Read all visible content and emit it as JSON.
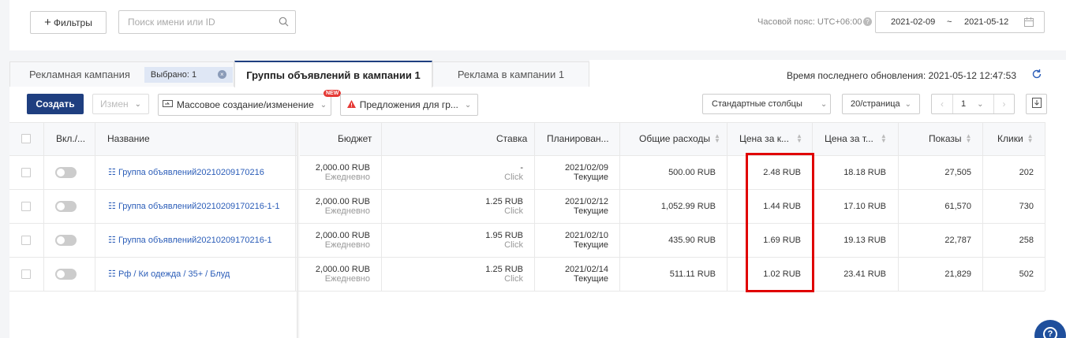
{
  "toolbar": {
    "filters_label": "Фильтры",
    "search_placeholder": "Поиск имени или ID",
    "timezone_label": "Часовой пояс: UTC+06:00",
    "date_start": "2021-02-09",
    "date_sep": "~",
    "date_end": "2021-05-12"
  },
  "tabs": {
    "campaign": "Рекламная кампания",
    "selected_badge": "Выбрано: 1",
    "groups": "Группы объявлений в кампании 1",
    "ads": "Реклама в кампании 1",
    "last_update": "Время последнего обновления: 2021-05-12 12:47:53"
  },
  "actions": {
    "create": "Создать",
    "edit": "Измен",
    "bulk": "Массовое создание/изменение",
    "new_badge": "NEW",
    "suggestions": "Предложения для гр...",
    "columns": "Стандартные столбцы",
    "page_size": "20/страница",
    "page": "1"
  },
  "columns": {
    "toggle": "Вкл./...",
    "name": "Название",
    "budget": "Бюджет",
    "bid": "Ставка",
    "schedule": "Планирован...",
    "spend": "Общие расходы",
    "cpc": "Цена за к...",
    "cpm": "Цена за т...",
    "impressions": "Показы",
    "clicks": "Клики"
  },
  "rows": [
    {
      "name": "Группа объявлений20210209170216",
      "budget": "2,000.00 RUB",
      "budget_type": "Ежедневно",
      "bid": "-",
      "bid_type": "Click",
      "date": "2021/02/09",
      "status": "Текущие",
      "spend": "500.00 RUB",
      "cpc": "2.48 RUB",
      "cpm": "18.18 RUB",
      "impressions": "27,505",
      "clicks": "202"
    },
    {
      "name": "Группа объявлений20210209170216-1-1",
      "budget": "2,000.00 RUB",
      "budget_type": "Ежедневно",
      "bid": "1.25 RUB",
      "bid_type": "Click",
      "date": "2021/02/12",
      "status": "Текущие",
      "spend": "1,052.99 RUB",
      "cpc": "1.44 RUB",
      "cpm": "17.10 RUB",
      "impressions": "61,570",
      "clicks": "730"
    },
    {
      "name": "Группа объявлений20210209170216-1",
      "budget": "2,000.00 RUB",
      "budget_type": "Ежедневно",
      "bid": "1.95 RUB",
      "bid_type": "Click",
      "date": "2021/02/10",
      "status": "Текущие",
      "spend": "435.90 RUB",
      "cpc": "1.69 RUB",
      "cpm": "19.13 RUB",
      "impressions": "22,787",
      "clicks": "258"
    },
    {
      "name": "Рф / Ки одежда / 35+ / Блуд",
      "budget": "2,000.00 RUB",
      "budget_type": "Ежедневно",
      "bid": "1.25 RUB",
      "bid_type": "Click",
      "date": "2021/02/14",
      "status": "Текущие",
      "spend": "511.11 RUB",
      "cpc": "1.02 RUB",
      "cpm": "23.41 RUB",
      "impressions": "21,829",
      "clicks": "502"
    }
  ],
  "highlight_color": "#e00000",
  "accent_color": "#1f3f80"
}
